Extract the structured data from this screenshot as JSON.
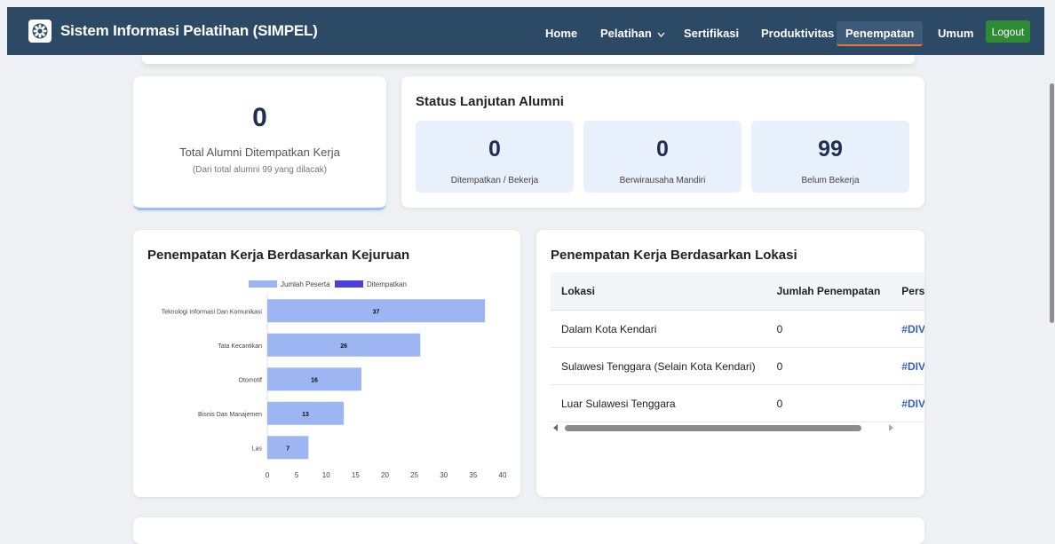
{
  "app": {
    "brand": "Sistem Informasi Pelatihan (SIMPEL)"
  },
  "nav": {
    "home": "Home",
    "pelatihan": "Pelatihan",
    "sertifikasi": "Sertifikasi",
    "produktivitas": "Produktivitas",
    "penempatan": "Penempatan",
    "umum": "Umum",
    "logout": "Logout"
  },
  "alumni": {
    "count": "0",
    "label": "Total Alumni Ditempatkan Kerja",
    "sublabel": "(Dari total alumni 99 yang dilacak)"
  },
  "status": {
    "title": "Status Lanjutan Alumni",
    "items": [
      {
        "value": "0",
        "label": "Ditempatkan / Bekerja"
      },
      {
        "value": "0",
        "label": "Berwirausaha Mandiri"
      },
      {
        "value": "99",
        "label": "Belum Bekerja"
      }
    ]
  },
  "kejuruan": {
    "title": "Penempatan Kerja Berdasarkan Kejuruan"
  },
  "chart_data": {
    "type": "bar",
    "orientation": "horizontal",
    "categories": [
      "Teknologi Informasi Dan Komunikasi",
      "Tata Kecantikan",
      "Otomotif",
      "Bisnis Dan Manajemen",
      "Las"
    ],
    "series": [
      {
        "name": "Jumlah Peserta",
        "values": [
          37,
          26,
          16,
          13,
          7
        ],
        "color": "#9db5f2"
      },
      {
        "name": "Ditempatkan",
        "values": [
          0,
          0,
          0,
          0,
          0
        ],
        "color": "#4b3fe0"
      }
    ],
    "data_labels": [
      "37",
      "26",
      "16",
      "13",
      "7"
    ],
    "xlim": [
      0,
      40
    ],
    "xticks": [
      "0",
      "5",
      "10",
      "15",
      "20",
      "25",
      "30",
      "35",
      "40"
    ],
    "legend": "top"
  },
  "lokasi": {
    "title": "Penempatan Kerja Berdasarkan Lokasi",
    "headers": [
      "Lokasi",
      "Jumlah Penempatan",
      "Pers"
    ],
    "rows": [
      [
        "Dalam Kota Kendari",
        "0",
        "#DIV"
      ],
      [
        "Sulawesi Tenggara (Selain Kota Kendari)",
        "0",
        "#DIV"
      ],
      [
        "Luar Sulawesi Tenggara",
        "0",
        "#DIV"
      ]
    ]
  },
  "colors": {
    "navbar": "#2c4a66",
    "accent": "#1f2f54",
    "logout": "#2e8b33",
    "active_underline": "#e8773a"
  }
}
